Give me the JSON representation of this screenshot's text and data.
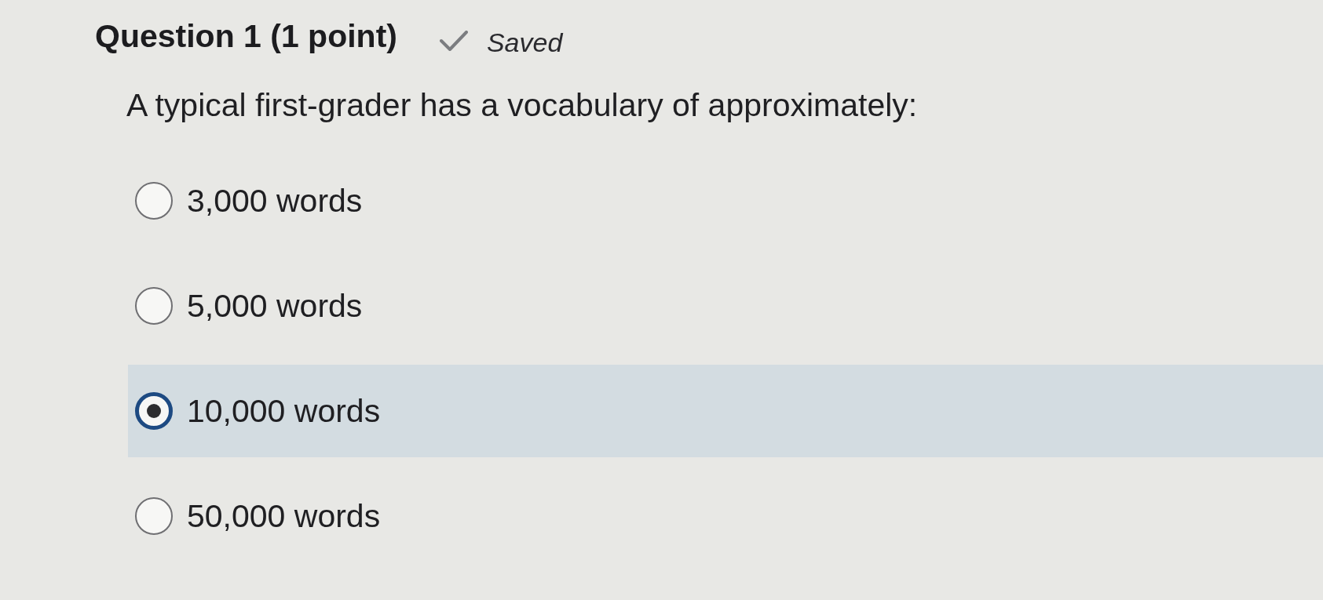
{
  "question": {
    "title": "Question 1 (1 point)",
    "status": "Saved",
    "prompt": "A typical first-grader has a vocabulary of approximately:"
  },
  "options": [
    {
      "label": "3,000 words",
      "selected": false
    },
    {
      "label": "5,000 words",
      "selected": false
    },
    {
      "label": "10,000 words",
      "selected": true
    },
    {
      "label": "50,000 words",
      "selected": false
    }
  ]
}
